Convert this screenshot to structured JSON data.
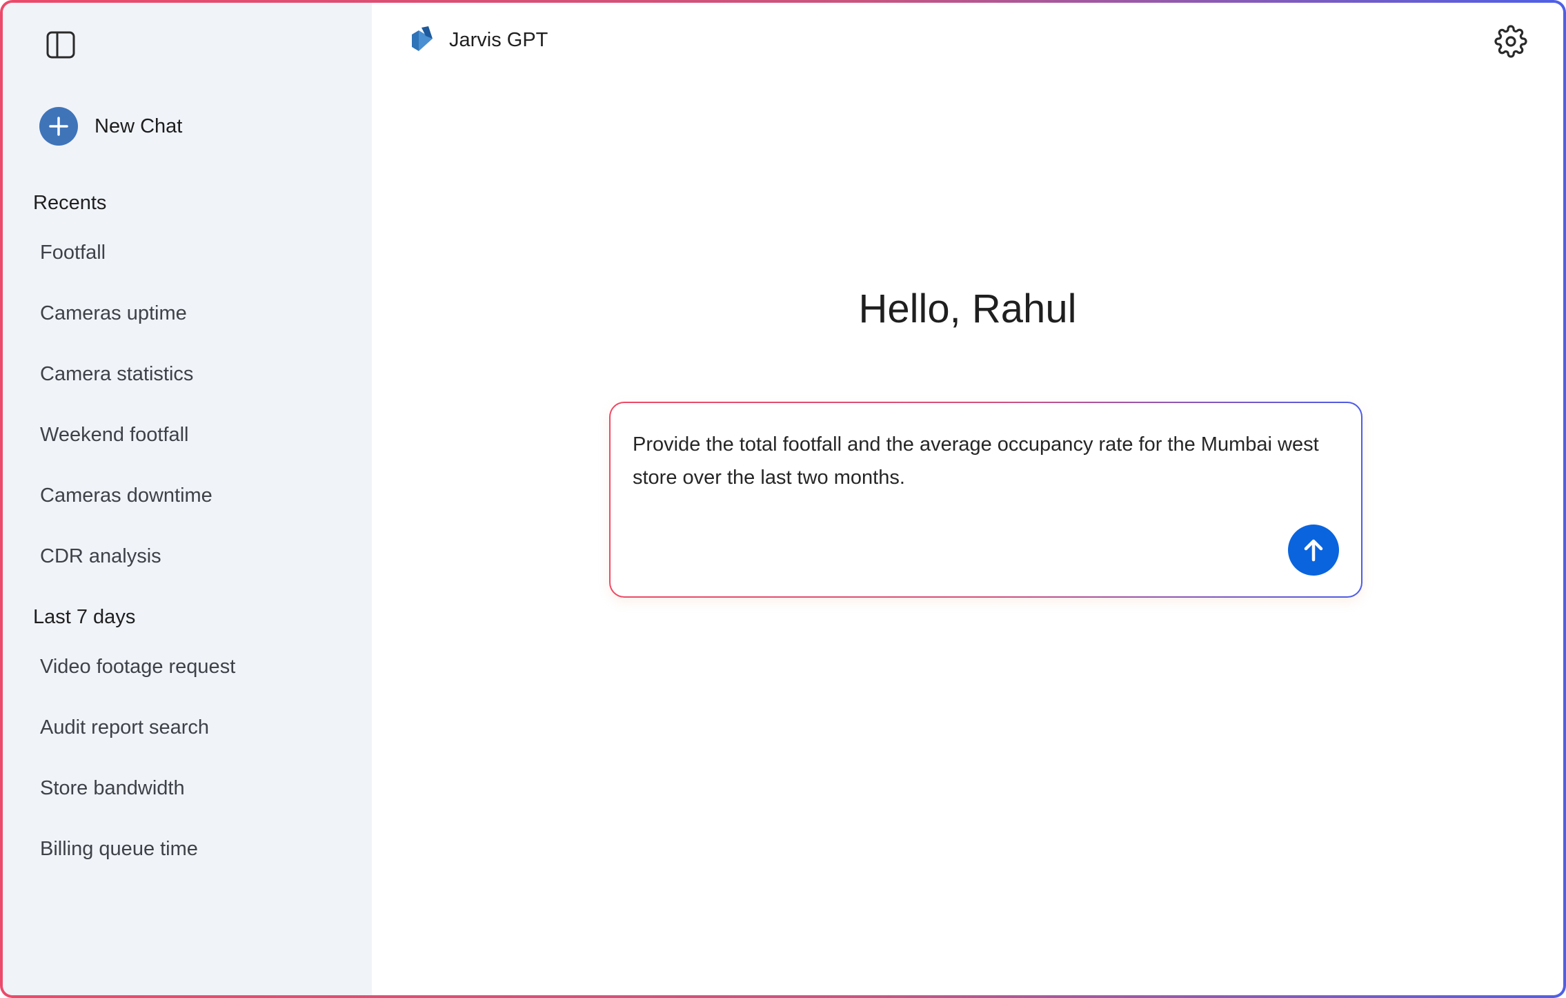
{
  "sidebar": {
    "new_chat_label": "New Chat",
    "recents_title": "Recents",
    "recents": [
      "Footfall",
      "Cameras uptime",
      "Camera statistics",
      "Weekend footfall",
      "Cameras downtime",
      "CDR analysis"
    ],
    "last7_title": "Last 7 days",
    "last7": [
      "Video footage request",
      "Audit report search",
      "Store bandwidth",
      "Billing queue time"
    ]
  },
  "header": {
    "app_name": "Jarvis GPT"
  },
  "main": {
    "greeting": "Hello, Rahul",
    "prompt_value": "Provide the total footfall and the average occupancy rate for the Mumbai west store over the last two months."
  },
  "icons": {
    "sidebar_toggle": "sidebar-toggle-icon",
    "new_chat": "plus-icon",
    "logo": "jarvis-logo-icon",
    "settings": "gear-icon",
    "send": "arrow-up-icon"
  },
  "colors": {
    "accent": "#0a64de",
    "new_chat": "#3f74b9",
    "sidebar_bg": "#f0f3f8",
    "gradient_start": "#ec4a6a",
    "gradient_end": "#4e60e6"
  }
}
